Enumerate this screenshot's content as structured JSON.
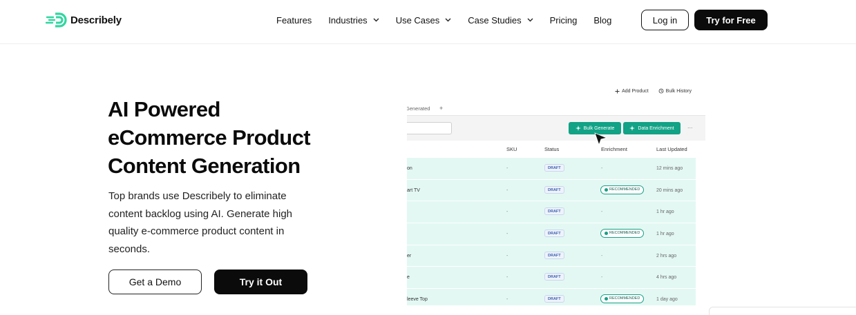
{
  "brand": {
    "name": "Describely",
    "accent": "#2fd7a0"
  },
  "nav": {
    "items": [
      {
        "label": "Features",
        "has_dropdown": false
      },
      {
        "label": "Industries",
        "has_dropdown": true
      },
      {
        "label": "Use Cases",
        "has_dropdown": true
      },
      {
        "label": "Case Studies",
        "has_dropdown": true
      },
      {
        "label": "Pricing",
        "has_dropdown": false
      },
      {
        "label": "Blog",
        "has_dropdown": false
      }
    ],
    "login_label": "Log in",
    "try_label": "Try for Free"
  },
  "hero": {
    "title_lines": [
      "AI Powered",
      "eCommerce Product",
      "Content Generation"
    ],
    "subtitle": "Top brands use Describely to eliminate content backlog using AI. Generate high quality e-commerce product content in seconds.",
    "demo_label": "Get a Demo",
    "tryout_label": "Try it Out"
  },
  "preview": {
    "add_product_label": "Add Product",
    "bulk_history_label": "Bulk History",
    "tab_label": "Generated",
    "tab_add": "+",
    "bulk_generate_label": "Bulk Generate",
    "data_enrichment_label": "Data Enrichment",
    "more_label": "...",
    "columns": [
      "SKU",
      "Status",
      "Enrichment",
      "Last Updated"
    ],
    "rows": [
      {
        "name": "on",
        "sku": "-",
        "status": "DRAFT",
        "enrichment": "-",
        "updated": "12 mins ago"
      },
      {
        "name": "art TV",
        "sku": "-",
        "status": "DRAFT",
        "enrichment": "RECOMMENDED",
        "updated": "20 mins ago"
      },
      {
        "name": "",
        "sku": "-",
        "status": "DRAFT",
        "enrichment": "-",
        "updated": "1 hr ago"
      },
      {
        "name": "",
        "sku": "-",
        "status": "DRAFT",
        "enrichment": "RECOMMENDED",
        "updated": "1 hr ago"
      },
      {
        "name": "er",
        "sku": "-",
        "status": "DRAFT",
        "enrichment": "-",
        "updated": "2 hrs ago"
      },
      {
        "name": "e",
        "sku": "-",
        "status": "DRAFT",
        "enrichment": "-",
        "updated": "4 hrs ago"
      },
      {
        "name": "leeve Top",
        "sku": "-",
        "status": "DRAFT",
        "enrichment": "RECOMMENDED",
        "updated": "1 day ago"
      }
    ]
  }
}
